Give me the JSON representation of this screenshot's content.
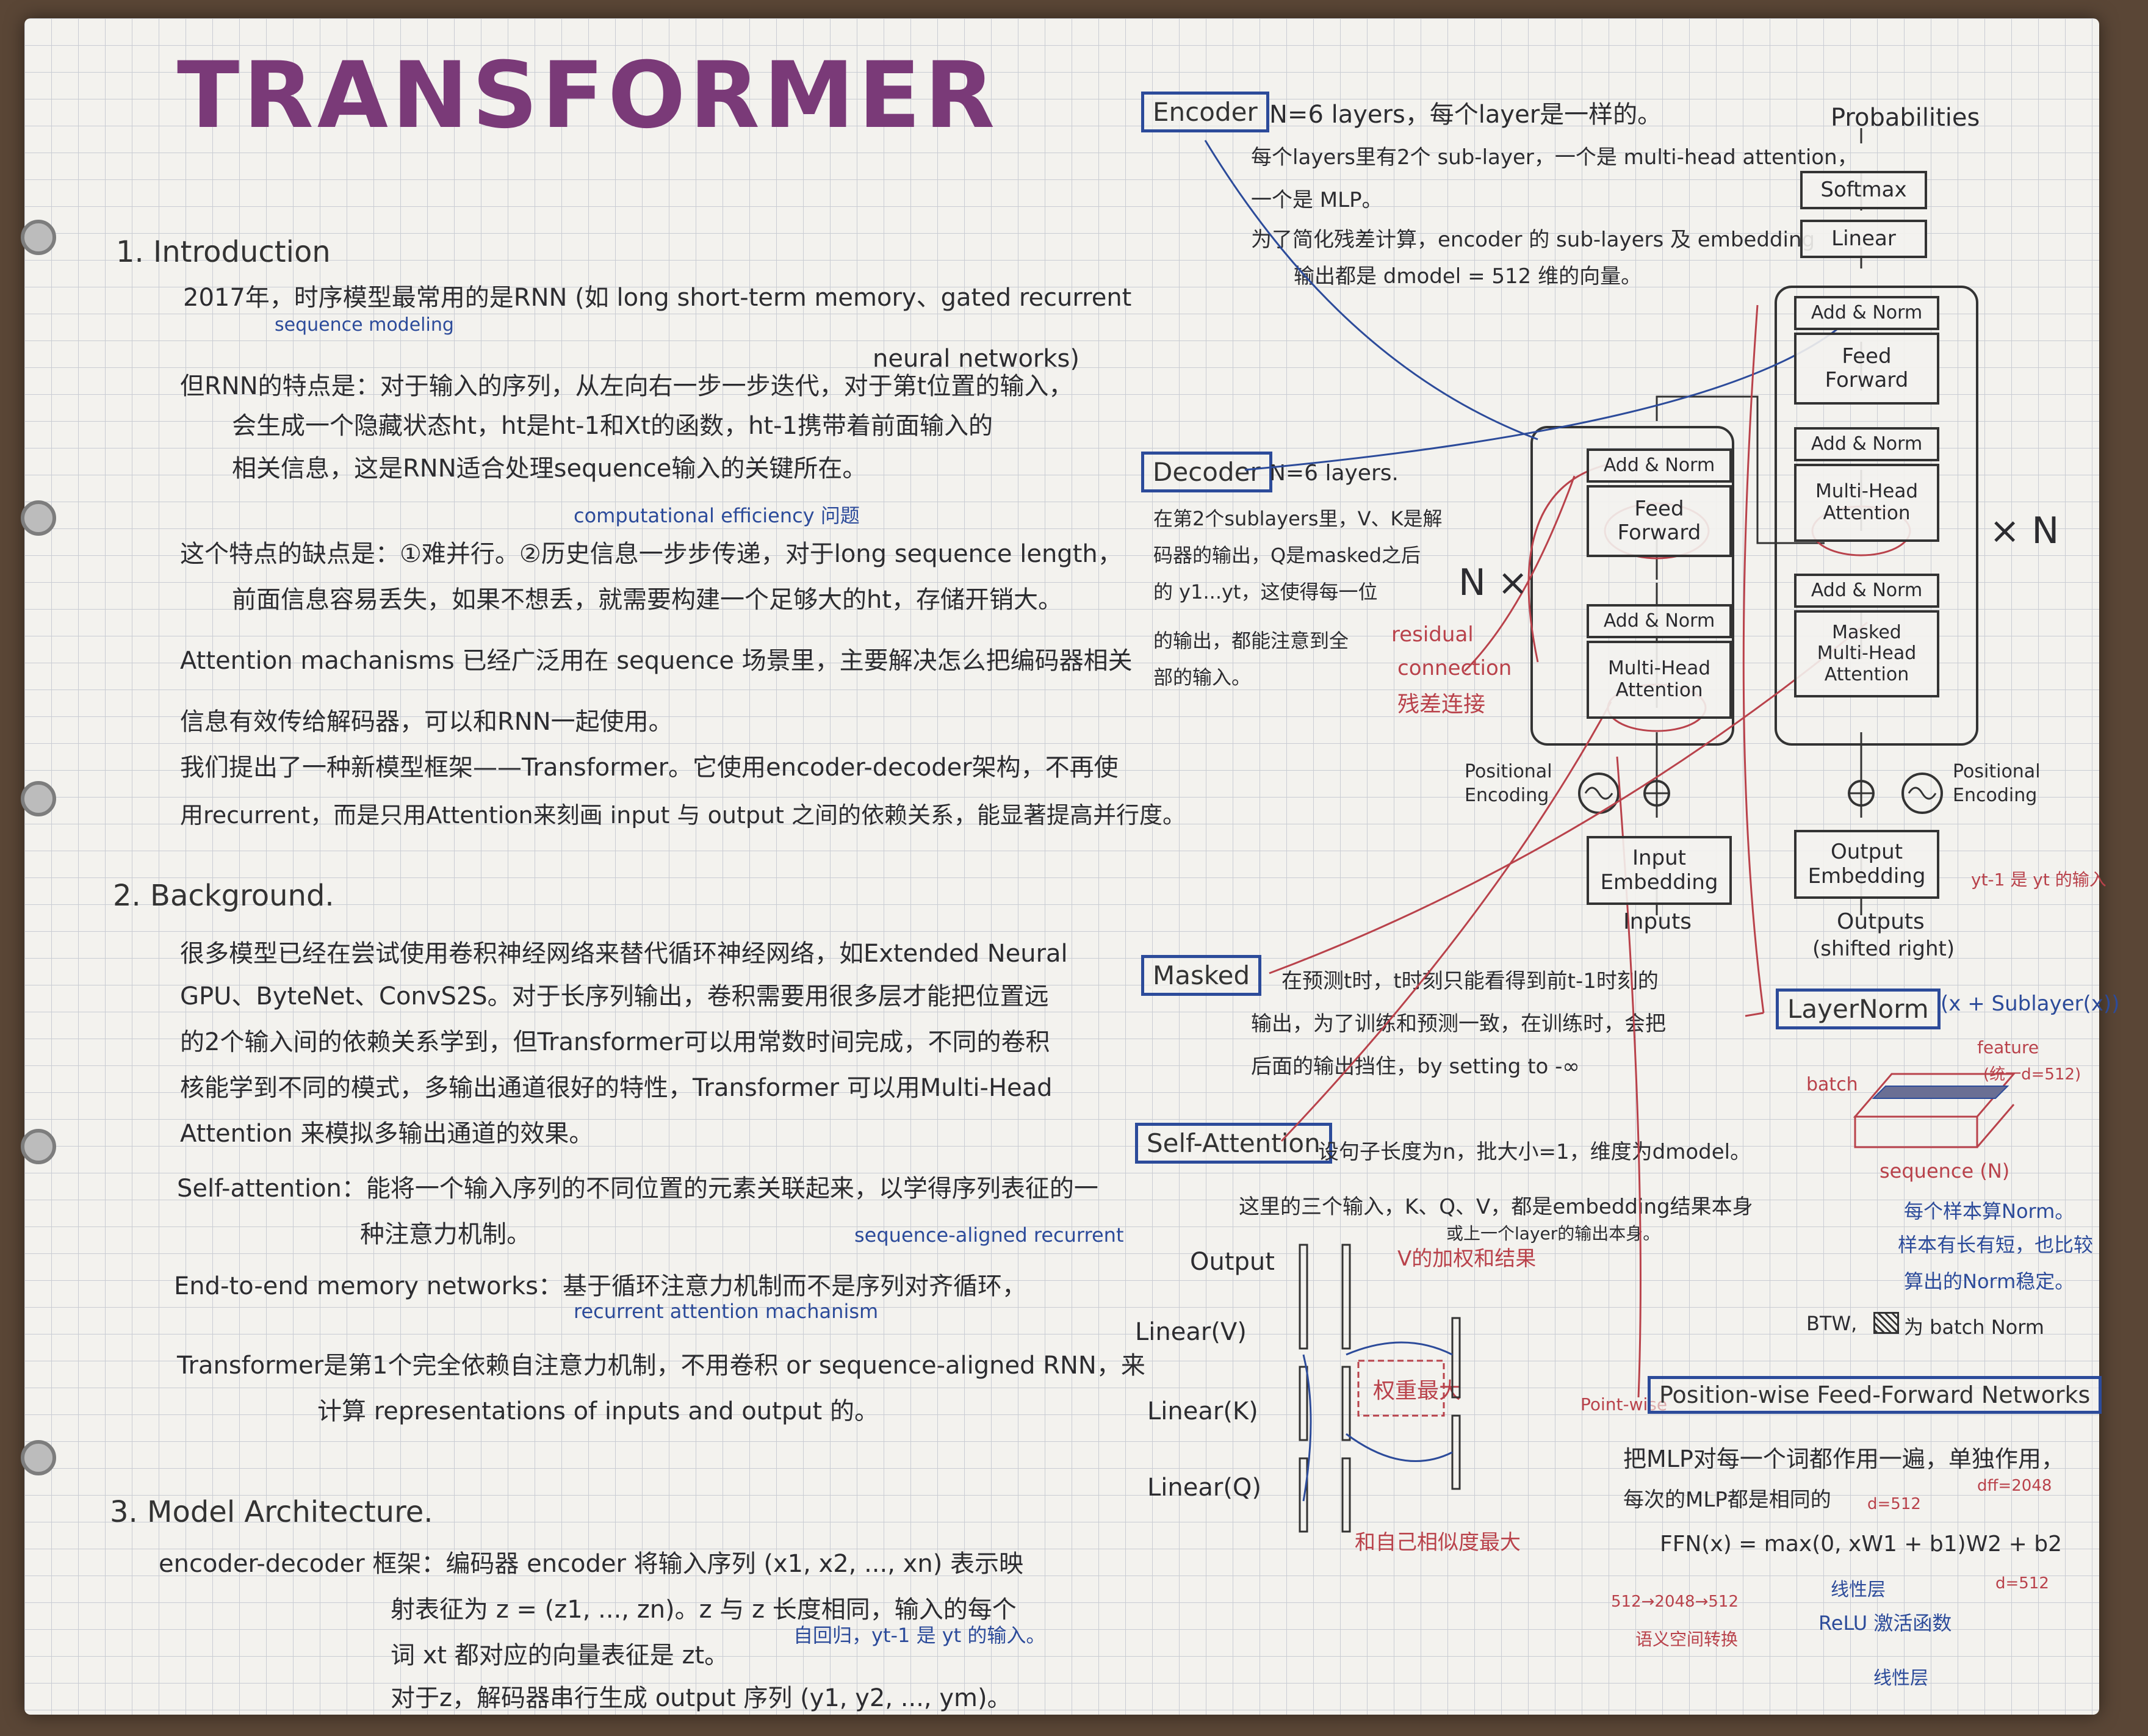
{
  "title": "TRANSFORMER",
  "sections": {
    "s1": {
      "heading": "1. Introduction",
      "lines": [
        "2017年，时序模型最常用的是RNN (如 long short-term memory、gated recurrent",
        "sequence modeling",
        "neural networks)",
        "但RNN的特点是：对于输入的序列，从左向右一步一步迭代，对于第t位置的输入，",
        "会生成一个隐藏状态ht，ht是ht-1和Xt的函数，ht-1携带着前面输入的",
        "相关信息，这是RNN适合处理sequence输入的关键所在。",
        "computational efficiency 问题",
        "这个特点的缺点是：①难并行。②历史信息一步步传递，对于long sequence length，",
        "前面信息容易丢失，如果不想丢，就需要构建一个足够大的ht，存储开销大。",
        "Attention machanisms 已经广泛用在 sequence 场景里，主要解决怎么把编码器相关",
        "信息有效传给解码器，可以和RNN一起使用。",
        "我们提出了一种新模型框架——Transformer。它使用encoder-decoder架构，不再使",
        "用recurrent，而是只用Attention来刻画 input 与 output 之间的依赖关系，能显著提高并行度。"
      ]
    },
    "s2": {
      "heading": "2. Background.",
      "lines": [
        "很多模型已经在尝试使用卷积神经网络来替代循环神经网络，如Extended Neural",
        "GPU、ByteNet、ConvS2S。对于长序列输出，卷积需要用很多层才能把位置远",
        "的2个输入间的依赖关系学到，但Transformer可以用常数时间完成，不同的卷积",
        "核能学到不同的模式，多输出通道很好的特性，Transformer 可以用Multi-Head",
        "Attention 来模拟多输出通道的效果。",
        "Self-attention：能将一个输入序列的不同位置的元素关联起来，以学得序列表征的一",
        "种注意力机制。",
        "sequence-aligned recurrent",
        "End-to-end memory networks：基于循环注意力机制而不是序列对齐循环，",
        "recurrent attention machanism",
        "Transformer是第1个完全依赖自注意力机制，不用卷积 or sequence-aligned RNN，来",
        "计算 representations of inputs and output 的。"
      ]
    },
    "s3": {
      "heading": "3. Model Architecture.",
      "lines": [
        "encoder-decoder 框架：编码器 encoder 将输入序列 (x1, x2, ..., xn) 表示映",
        "射表征为 z = (z1, ..., zn)。z 与 z 长度相同，输入的每个",
        "词 xt 都对应的向量表征是 zt。",
        "自回归，yt-1 是 yt 的输入。",
        "对于z，解码器串行生成 output 序列 (y1, y2, ..., ym)。"
      ]
    }
  },
  "notes": {
    "encoder": {
      "tag": "Encoder",
      "lines": [
        "N=6 layers，每个layer是一样的。",
        "每个layers里有2个 sub-layer，一个是 multi-head attention，",
        "一个是 MLP。",
        "为了简化残差计算，encoder 的 sub-layers 及 embedding",
        "输出都是 dmodel = 512 维的向量。"
      ]
    },
    "decoder": {
      "tag": "Decoder",
      "first": "N=6 layers.",
      "lines": [
        "在第2个sublayers里，V、K是解",
        "码器的输出，Q是masked之后",
        "的 y1...yt，这使得每一位",
        "的输出，都能注意到全",
        "部的输入。"
      ]
    },
    "residual": [
      "residual",
      "connection",
      "残差连接"
    ],
    "masked": {
      "tag": "Masked",
      "lines": [
        "在预测t时，t时刻只能看得到前t-1时刻的",
        "输出，为了训练和预测一致，在训练时，会把",
        "后面的输出挡住，by setting to -∞"
      ]
    },
    "self_attention": {
      "tag": "Self-Attention",
      "line1": "设句子长度为n，批大小=1，维度为dmodel。",
      "line2": "这里的三个输入，K、Q、V，都是embedding结果本身",
      "line3": "或上一个layer的输出本身。",
      "output": "Output",
      "v_note": "V的加权和结果",
      "weight_note": "权重最大",
      "similar_note": "和自己相似度最大",
      "linear_v": "Linear(V)",
      "linear_k": "Linear(K)",
      "linear_q": "Linear(Q)"
    },
    "layernorm": {
      "tag": "LayerNorm",
      "formula": "(x + Sublayer(x))",
      "feature": "feature",
      "feature_d": "(统一d=512)",
      "batch": "batch",
      "sequence": "sequence (N)",
      "per_sample": "每个样本算Norm。",
      "stable": "样本有长有短，也比较",
      "stable2": "算出的Norm稳定。",
      "btw": "BTW,",
      "btw2": "为 batch Norm"
    },
    "ffn": {
      "prefix": "Point-wise",
      "tag": "Position-wise Feed-Forward Networks",
      "line1": "把MLP对每一个词都作用一遍，单独作用，",
      "line2": "每次的MLP都是相同的",
      "formula": "FFN(x) = max(0, xW1 + b1)W2 + b2",
      "d512a": "d=512",
      "dff": "dff=2048",
      "d512b": "d=512",
      "lin1": "线性层",
      "relu": "ReLU 激活函数",
      "lin2": "线性层",
      "dims": "512→2048→512",
      "semantic": "语义空间转换"
    }
  },
  "diagram": {
    "probabilities": "Probabilities",
    "softmax": "Softmax",
    "linear": "Linear",
    "add_norm": "Add & Norm",
    "feed_forward": "Feed\nForward",
    "multi_head": "Multi-Head\nAttention",
    "masked_mha": "Masked\nMulti-Head\nAttention",
    "input_embedding": "Input\nEmbedding",
    "output_embedding": "Output\nEmbedding",
    "inputs": "Inputs",
    "outputs": "Outputs",
    "shifted": "(shifted right)",
    "pos_enc_left": "Positional\nEncoding",
    "pos_enc_right": "Positional\nEncoding",
    "nx_left": "N ×",
    "nx_right": "× N",
    "yt_note": "yt-1 是 yt 的输入"
  },
  "colors": {
    "ink": "#2c2c30",
    "blue": "#2c4b9a",
    "red": "#b9424b",
    "title": "#7a3a78"
  }
}
